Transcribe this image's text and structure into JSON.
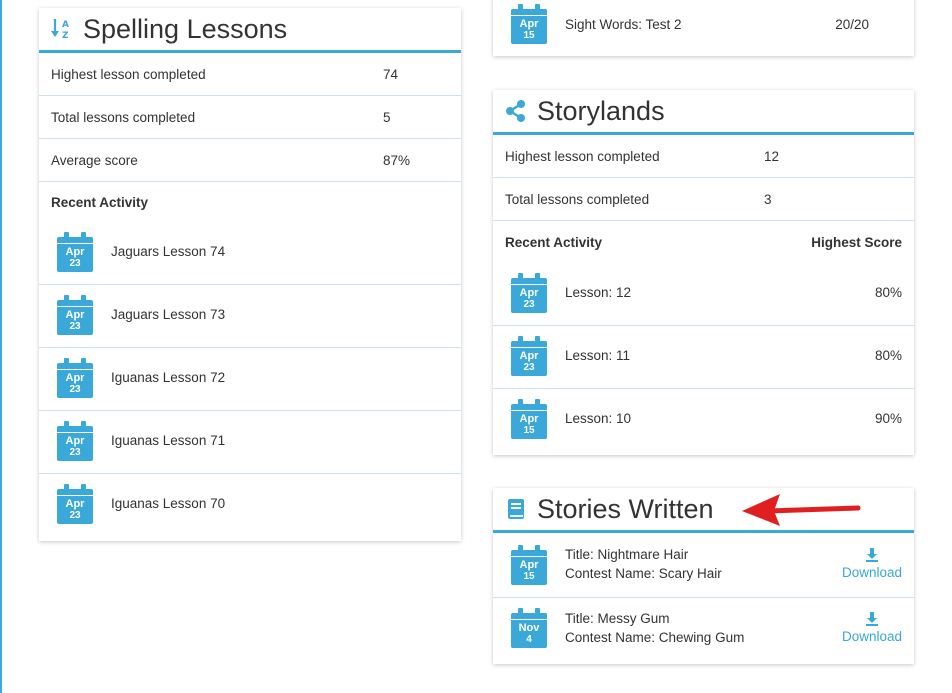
{
  "spelling": {
    "title": "Spelling Lessons",
    "stats": [
      {
        "label": "Highest lesson completed",
        "value": "74"
      },
      {
        "label": "Total lessons completed",
        "value": "5"
      },
      {
        "label": "Average score",
        "value": "87%"
      }
    ],
    "recent_label": "Recent Activity",
    "activity": [
      {
        "month": "Apr",
        "day": "23",
        "text": "Jaguars Lesson 74"
      },
      {
        "month": "Apr",
        "day": "23",
        "text": "Jaguars Lesson 73"
      },
      {
        "month": "Apr",
        "day": "23",
        "text": "Iguanas Lesson 72"
      },
      {
        "month": "Apr",
        "day": "23",
        "text": "Iguanas Lesson 71"
      },
      {
        "month": "Apr",
        "day": "23",
        "text": "Iguanas Lesson 70"
      }
    ]
  },
  "sight_words": {
    "row": {
      "month": "Apr",
      "day": "15",
      "text": "Sight Words: Test 2",
      "score": "20/20"
    }
  },
  "storylands": {
    "title": "Storylands",
    "stats": [
      {
        "label": "Highest lesson completed",
        "value": "12"
      },
      {
        "label": "Total lessons completed",
        "value": "3"
      }
    ],
    "recent_label": "Recent Activity",
    "score_label": "Highest Score",
    "activity": [
      {
        "month": "Apr",
        "day": "23",
        "text": "Lesson: 12",
        "score": "80%"
      },
      {
        "month": "Apr",
        "day": "23",
        "text": "Lesson: 11",
        "score": "80%"
      },
      {
        "month": "Apr",
        "day": "15",
        "text": "Lesson: 10",
        "score": "90%"
      }
    ]
  },
  "stories": {
    "title": "Stories Written",
    "items": [
      {
        "month": "Apr",
        "day": "15",
        "title_line": "Title: Nightmare Hair",
        "contest_line": "Contest Name: Scary Hair",
        "download": "Download"
      },
      {
        "month": "Nov",
        "day": "4",
        "title_line": "Title: Messy Gum",
        "contest_line": "Contest Name: Chewing Gum",
        "download": "Download"
      }
    ]
  },
  "colors": {
    "accent": "#3aa8d8",
    "arrow": "#e02020"
  }
}
